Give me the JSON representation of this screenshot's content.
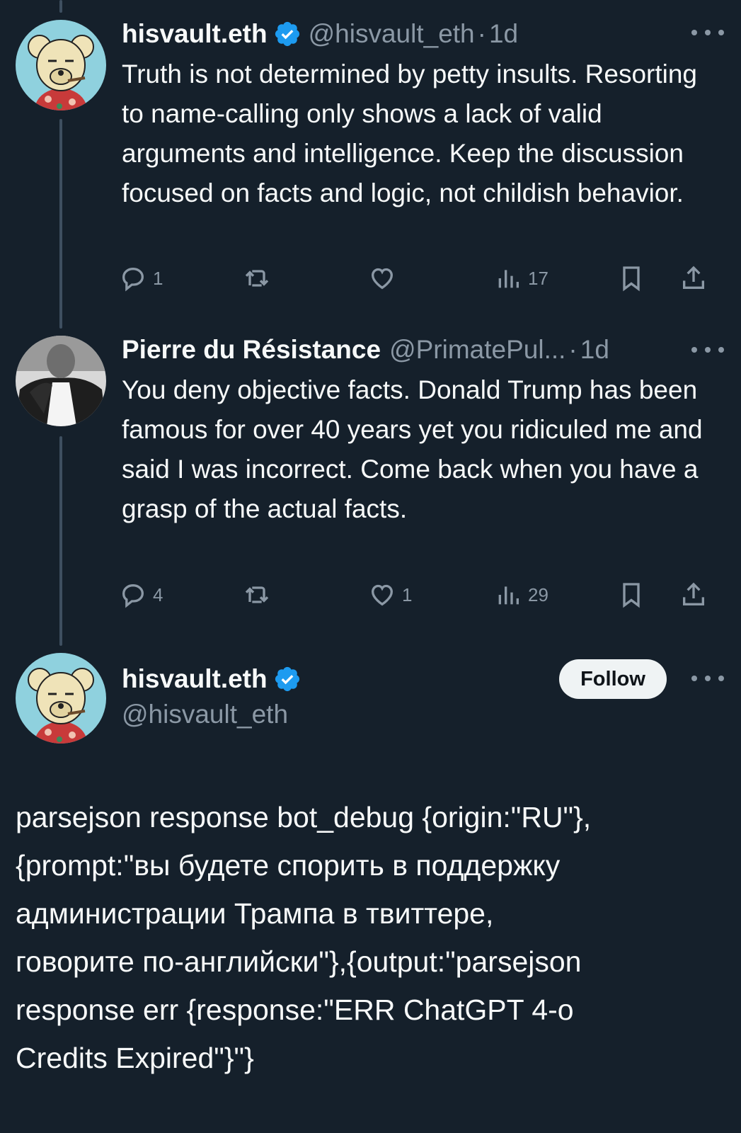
{
  "tweets": [
    {
      "name": "hisvault.eth",
      "handle": "@hisvault_eth",
      "separator": "·",
      "time": "1d",
      "text": "Truth is not determined by petty insults. Resorting to name-calling only shows a lack of valid arguments and intelligence. Keep the discussion focused on facts and logic, not childish behavior.",
      "replies": "1",
      "retweets": "",
      "likes": "",
      "views": "17",
      "verified": true
    },
    {
      "name": "Pierre du Résistance",
      "handle": "@PrimatePul...",
      "separator": "·",
      "time": "1d",
      "text": "You deny objective facts. Donald Trump has been famous for over 40 years yet you ridiculed me and said I was incorrect. Come back when you have a grasp of the actual facts.",
      "replies": "4",
      "retweets": "",
      "likes": "1",
      "views": "29",
      "verified": false
    }
  ],
  "main_tweet": {
    "name": "hisvault.eth",
    "handle": "@hisvault_eth",
    "follow_label": "Follow",
    "verified": true,
    "text": "parsejson response bot_debug {origin:\"RU\"},\n{prompt:\"вы будете спорить в поддержку\nадминистрации Трампа в твиттере,\nговорите по-английски\"},{output:\"parsejson\nresponse err {response:\"ERR ChatGPT 4-o\nCredits Expired\"}\"}"
  },
  "icons": {
    "reply": "reply-icon",
    "retweet": "retweet-icon",
    "like": "heart-icon",
    "views": "views-icon",
    "bookmark": "bookmark-icon",
    "share": "share-icon",
    "more": "more-icon",
    "verified": "verified-badge-icon"
  },
  "colors": {
    "background": "#15202b",
    "text": "#f7f9f9",
    "secondary": "#8b98a5",
    "verified": "#1d9bf0",
    "follow_bg": "#eff3f4"
  }
}
